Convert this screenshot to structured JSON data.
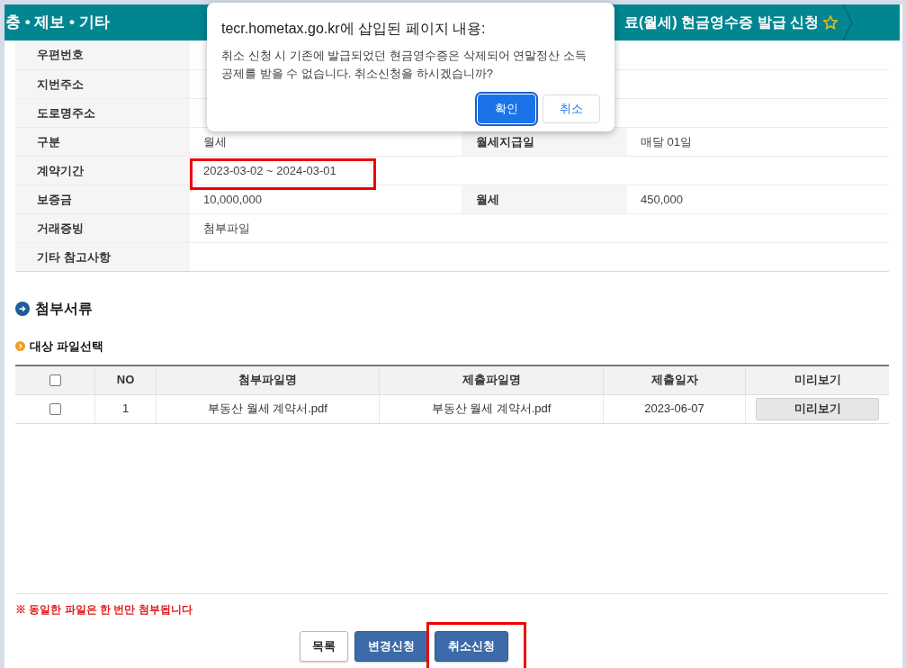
{
  "header": {
    "left_text": "충 • 제보 • 기타",
    "title": "료(월세) 현금영수증 발급 신청",
    "favorite": false
  },
  "info_rows": [
    {
      "label": "우편번호"
    },
    {
      "label": "지번주소"
    },
    {
      "label": "도로명주소"
    },
    {
      "label": "구분",
      "value": "월세",
      "label2": "월세지급일",
      "value2": "매달 01일"
    },
    {
      "label": "계약기간",
      "value": "2023-03-02 ~ 2024-03-01",
      "highlighted": true
    },
    {
      "label": "보증금",
      "value": "10,000,000",
      "label2": "월세",
      "value2": "450,000"
    },
    {
      "label": "거래증빙",
      "value": "첨부파일"
    },
    {
      "label": "기타 참고사항"
    }
  ],
  "section_title": "첨부서류",
  "subsection_title": "대상 파일선택",
  "file_table": {
    "select_all_checked": false,
    "columns": [
      "NO",
      "첨부파일명",
      "제출파일명",
      "제출일자",
      "미리보기"
    ],
    "rows": [
      {
        "checked": false,
        "no": "1",
        "attached_name": "부동산 월세 계약서.pdf",
        "submitted_name": "부동산 월세 계약서.pdf",
        "date": "2023-06-07",
        "preview": "미리보기"
      }
    ]
  },
  "notice": "※ 동일한 파일은 한 번만 첨부됩니다",
  "buttons": [
    {
      "label": "목록",
      "kind": "default",
      "highlighted": false
    },
    {
      "label": "변경신청",
      "kind": "primary",
      "highlighted": false
    },
    {
      "label": "취소신청",
      "kind": "primary",
      "highlighted": true
    }
  ],
  "dialog": {
    "title": "tecr.hometax.go.kr에 삽입된 페이지 내용:",
    "message": "취소 신청 시 기존에 발급되었던 현금영수증은 삭제되어 연말정산 소득 공제를 받을 수 없습니다. 취소신청을 하시겠습니까?",
    "buttons": [
      {
        "label": "확인",
        "kind": "primary"
      },
      {
        "label": "취소",
        "kind": "secondary"
      }
    ]
  }
}
